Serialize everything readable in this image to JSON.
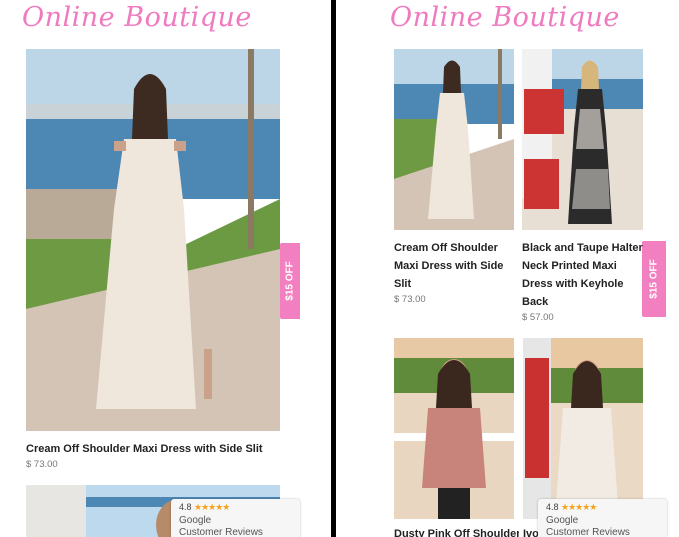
{
  "brand": {
    "name": "Online Boutique",
    "color": "#f07ac0"
  },
  "promo": {
    "label": "$15 OFF",
    "color": "#f27fbf"
  },
  "google_badge": {
    "rating": "4.8",
    "stars": "★★★★★",
    "brand": "Google",
    "subtitle": "Customer Reviews"
  },
  "products": [
    {
      "title": "Cream Off Shoulder Maxi Dress with Side Slit",
      "price": "$ 73.00"
    },
    {
      "title": "Black and Taupe Halter Neck Printed Maxi Dress with Keyhole Back",
      "price": "$ 57.00"
    },
    {
      "title": "Dusty Pink Off Shoulder",
      "price": ""
    },
    {
      "title": "Ivory",
      "price": ""
    }
  ],
  "right_titles": {
    "p1": [
      "Cream Off Shoulder",
      "Maxi Dress with Side",
      "Slit"
    ],
    "p2": [
      "Black and Taupe Halter",
      "Neck Printed Maxi",
      "Dress with Keyhole",
      "Back"
    ],
    "p3": "Dusty Pink Off Shoulder",
    "p4": "Ivo"
  }
}
